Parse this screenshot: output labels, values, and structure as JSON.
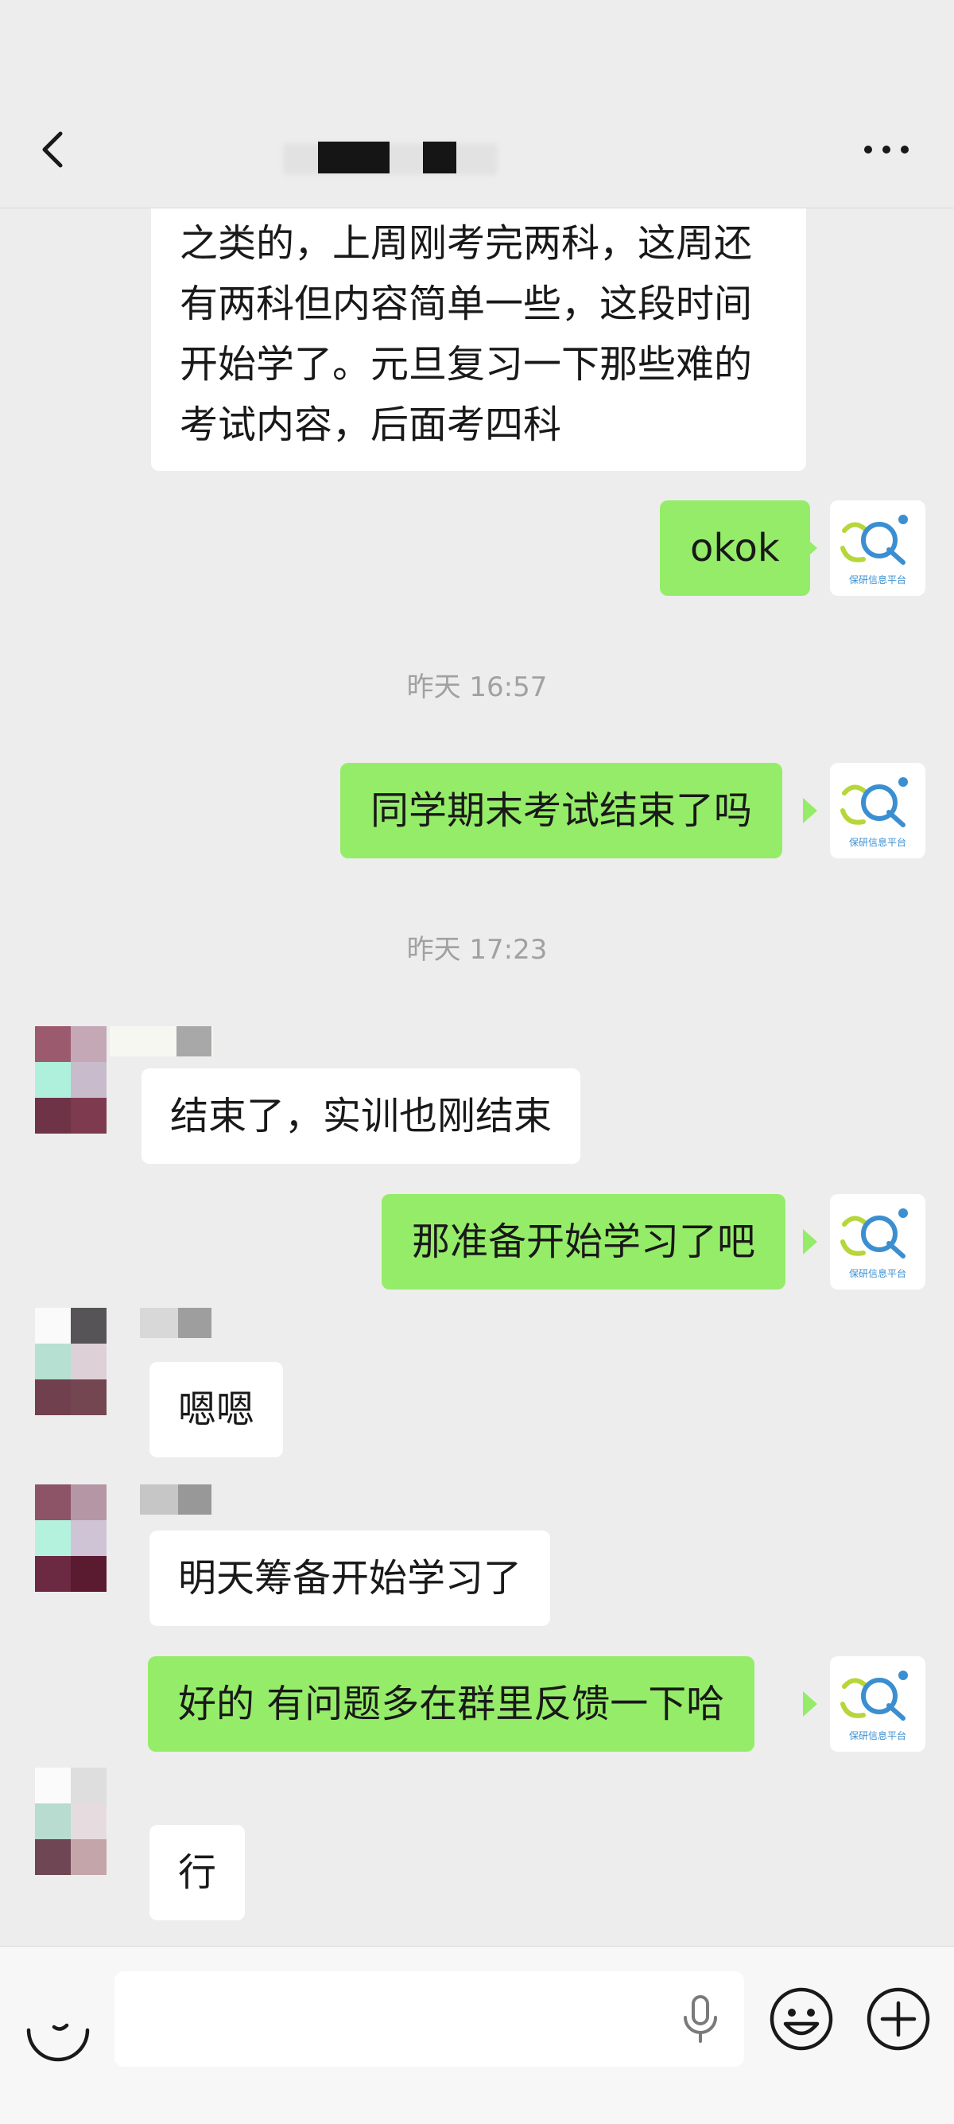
{
  "header": {
    "title": "",
    "back_icon": "chevron-left-icon",
    "more_icon": "more-dots-icon"
  },
  "colors": {
    "outgoing_bubble": "#95ec69",
    "incoming_bubble": "#ffffff",
    "background": "#ededed",
    "timestamp": "#a1a1a1"
  },
  "my_avatar": {
    "caption": "保研信息平台"
  },
  "timestamps": [
    "昨天 16:57",
    "昨天 17:23"
  ],
  "messages": [
    {
      "dir": "in",
      "text": "之类的，上周刚考完两科，这周还\n有两科但内容简单一些，这段时间\n开始学了。元旦复习一下那些难的\n考试内容，后面考四科"
    },
    {
      "dir": "out",
      "text": "okok"
    },
    {
      "dir": "out",
      "text": "同学期末考试结束了吗"
    },
    {
      "dir": "in",
      "text": "结束了，实训也刚结束"
    },
    {
      "dir": "out",
      "text": "那准备开始学习了吧"
    },
    {
      "dir": "in",
      "text": "嗯嗯"
    },
    {
      "dir": "in",
      "text": "明天筹备开始学习了"
    },
    {
      "dir": "out",
      "text": "好的 有问题多在群里反馈一下哈"
    },
    {
      "dir": "in",
      "text": "行"
    }
  ],
  "input_bar": {
    "placeholder": "",
    "voice_icon": "voice-toggle-icon",
    "mic_icon": "microphone-icon",
    "emoji_icon": "emoji-icon",
    "plus_icon": "plus-icon"
  }
}
